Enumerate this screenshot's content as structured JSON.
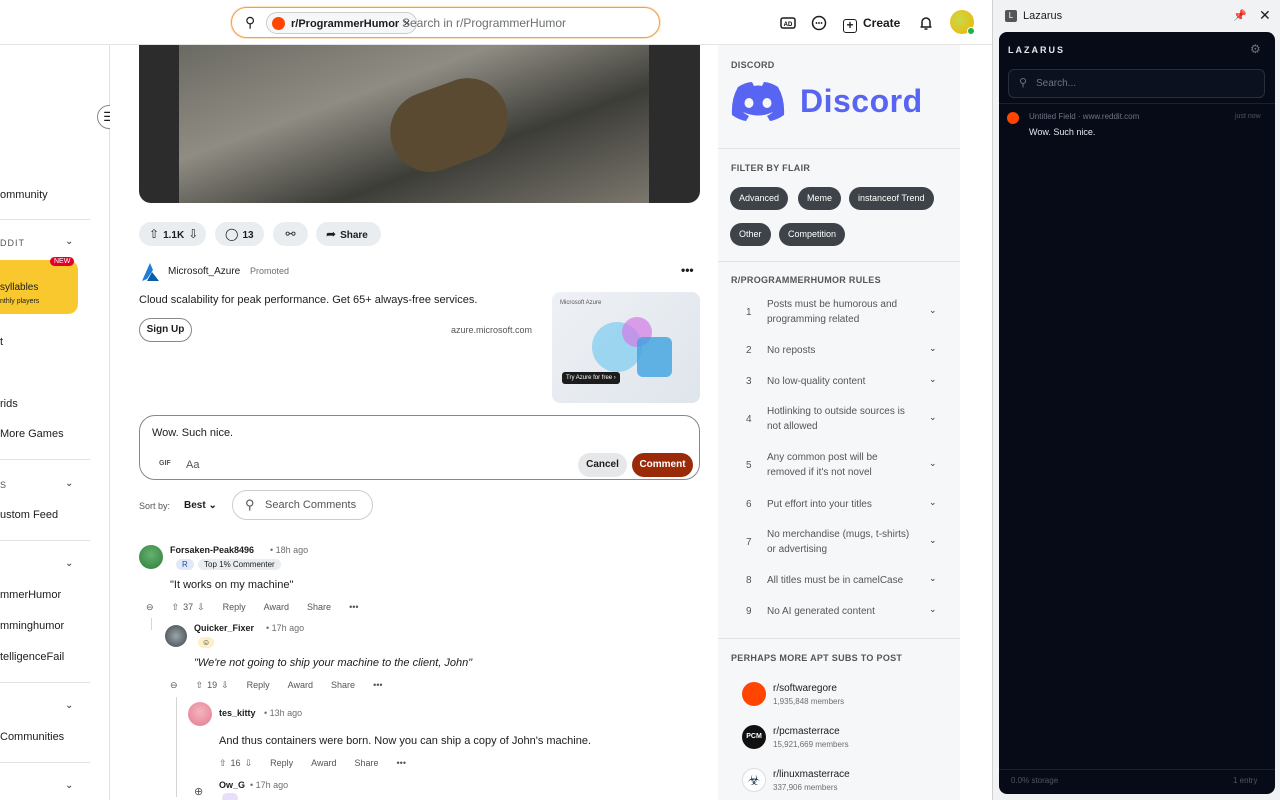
{
  "topbar": {
    "subreddit_chip": "r/ProgrammerHumor",
    "chip_close": "×",
    "search_placeholder": "Search in r/ProgrammerHumor",
    "create_label": "Create"
  },
  "sidebar": {
    "items": [
      {
        "label": "ommunity"
      },
      {
        "label": "DDIT",
        "section": true
      },
      {
        "label": "syllables"
      },
      {
        "label": "nthly players"
      },
      {
        "label": "t"
      },
      {
        "label": "rids"
      },
      {
        "label": "More Games"
      },
      {
        "label": "S",
        "section": true
      },
      {
        "label": "ustom Feed"
      },
      {
        "label": "mmerHumor"
      },
      {
        "label": "mminghumor"
      },
      {
        "label": "telligenceFail"
      },
      {
        "label": "Communities"
      }
    ],
    "game_badge": "NEW"
  },
  "post": {
    "votes": "1.1K",
    "comments": "13",
    "share": "Share"
  },
  "ad": {
    "advertiser": "Microsoft_Azure",
    "promoted": "Promoted",
    "more": "•••",
    "text": "Cloud scalability for peak performance. Get 65+ always-free services.",
    "cta": "Sign Up",
    "domain": "azure.microsoft.com",
    "image_brand": "Microsoft Azure",
    "image_cta": "Try Azure for free ›"
  },
  "composer": {
    "value": "Wow. Such nice.",
    "gif": "GIF",
    "format": "Aa",
    "cancel": "Cancel",
    "submit": "Comment"
  },
  "sort": {
    "label": "Sort by:",
    "value": "Best",
    "search_placeholder": "Search Comments"
  },
  "comments": [
    {
      "author": "Forsaken-Peak8496",
      "time": "• 18h ago",
      "flair": "Top 1% Commenter",
      "flair_letter": "R",
      "body": "\"It works on my machine\"",
      "votes": "37",
      "reply": "Reply",
      "award": "Award",
      "share": "Share",
      "more": "•••"
    },
    {
      "author": "Quicker_Fixer",
      "time": "• 17h ago",
      "body": "\"We're not going to ship your machine to the client, John\"",
      "votes": "19",
      "reply": "Reply",
      "award": "Award",
      "share": "Share",
      "more": "•••"
    },
    {
      "author": "tes_kitty",
      "time": "• 13h ago",
      "body": "And thus containers were born. Now you can ship a copy of John's machine.",
      "votes": "16",
      "reply": "Reply",
      "award": "Award",
      "share": "Share",
      "more": "•••"
    },
    {
      "author": "Ow_G",
      "time": "• 17h ago"
    }
  ],
  "right": {
    "discord_head": "DISCORD",
    "discord_word": "Discord",
    "flair_head": "FILTER BY FLAIR",
    "flairs": [
      "Advanced",
      "Meme",
      "instanceof Trend",
      "Other",
      "Competition"
    ],
    "rules_head": "R/PROGRAMMERHUMOR RULES",
    "rules": [
      {
        "n": "1",
        "t": "Posts must be humorous and programming related"
      },
      {
        "n": "2",
        "t": "No reposts"
      },
      {
        "n": "3",
        "t": "No low-quality content"
      },
      {
        "n": "4",
        "t": "Hotlinking to outside sources is not allowed"
      },
      {
        "n": "5",
        "t": "Any common post will be removed if it's not novel"
      },
      {
        "n": "6",
        "t": "Put effort into your titles"
      },
      {
        "n": "7",
        "t": "No merchandise (mugs, t-shirts) or advertising"
      },
      {
        "n": "8",
        "t": "All titles must be in camelCase"
      },
      {
        "n": "9",
        "t": "No AI generated content"
      }
    ],
    "subs_head": "PERHAPS MORE APT SUBS TO POST",
    "subs": [
      {
        "name": "r/softwaregore",
        "members": "1,935,848 members",
        "color": "#ff4500"
      },
      {
        "name": "r/pcmasterrace",
        "members": "15,921,669 members",
        "color": "#111111"
      },
      {
        "name": "r/linuxmasterrace",
        "members": "337,906 members",
        "color": "#ffffff"
      }
    ]
  },
  "lazarus": {
    "window_title": "Lazarus",
    "logo_letter": "L",
    "heading": "LAZARUS",
    "search_placeholder": "Search...",
    "entry_source": "Untitled Field · www.reddit.com",
    "entry_time": "just now",
    "entry_text": "Wow. Such nice.",
    "storage": "0.0% storage",
    "count": "1 entry"
  },
  "colors": {
    "accent": "#9b2a08",
    "discord": "#5865f2",
    "reddit": "#ff4500"
  }
}
